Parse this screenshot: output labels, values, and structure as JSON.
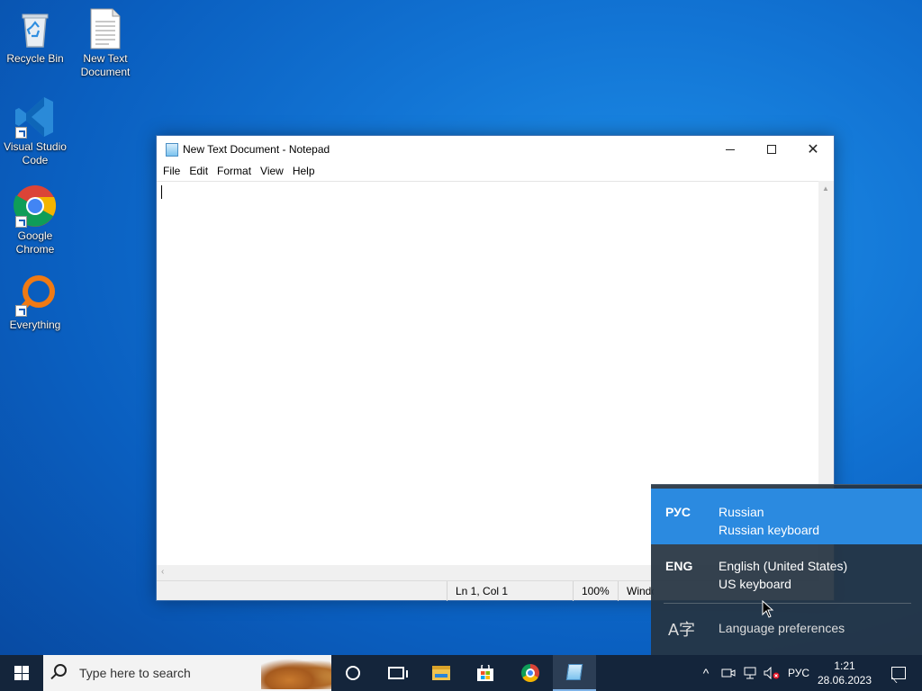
{
  "desktop": {
    "icons": [
      {
        "label": "Recycle Bin"
      },
      {
        "label": "New Text Document"
      },
      {
        "label": "Visual Studio Code"
      },
      {
        "label": "Google Chrome"
      },
      {
        "label": "Everything"
      }
    ]
  },
  "notepad": {
    "title": "New Text Document - Notepad",
    "menu": [
      "File",
      "Edit",
      "Format",
      "View",
      "Help"
    ],
    "content": "",
    "status": {
      "position": "Ln 1, Col 1",
      "zoom": "100%",
      "line_ending": "Windo"
    }
  },
  "language_flyout": {
    "items": [
      {
        "code": "РУС",
        "name": "Russian",
        "keyboard": "Russian keyboard",
        "selected": true
      },
      {
        "code": "ENG",
        "name": "English (United States)",
        "keyboard": "US keyboard",
        "selected": false
      }
    ],
    "preferences_label": "Language preferences"
  },
  "taskbar": {
    "search_placeholder": "Type here to search",
    "pinned": [
      "cortana-icon",
      "task-view-icon",
      "file-explorer-icon",
      "microsoft-store-icon",
      "chrome-icon",
      "notepad-icon"
    ],
    "tray": {
      "language": "РУС",
      "time": "1:21",
      "date": "28.06.2023"
    }
  },
  "colors": {
    "flyout_selected": "#2b8ae0",
    "flyout_bg": "#263442",
    "taskbar_bg": "#14253b"
  }
}
